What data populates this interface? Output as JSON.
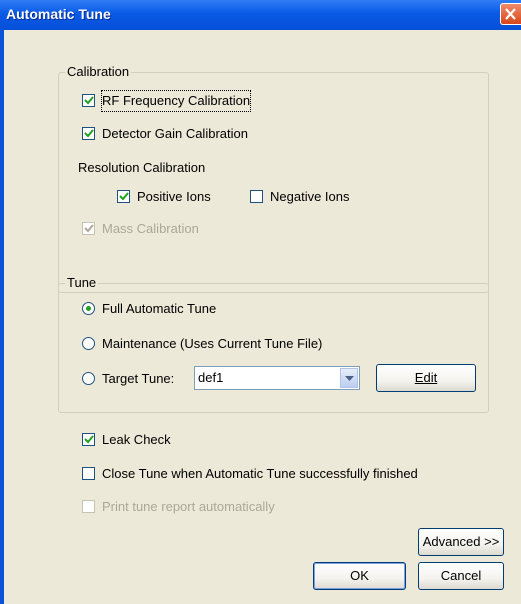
{
  "window": {
    "title": "Automatic Tune"
  },
  "calibration": {
    "label": "Calibration",
    "rf_frequency": {
      "label": "RF Frequency Calibration",
      "checked": true
    },
    "detector_gain": {
      "label": "Detector Gain Calibration",
      "checked": true
    },
    "resolution_label": "Resolution Calibration",
    "positive_ions": {
      "label": "Positive Ions",
      "checked": true
    },
    "negative_ions": {
      "label": "Negative Ions",
      "checked": false
    },
    "mass_calibration": {
      "label": "Mass Calibration",
      "checked": true,
      "disabled": true
    }
  },
  "tune": {
    "label": "Tune",
    "full_auto": {
      "label": "Full Automatic Tune",
      "selected": true
    },
    "maintenance": {
      "label": "Maintenance (Uses Current Tune File)",
      "selected": false
    },
    "target": {
      "label": "Target Tune:",
      "selected": false,
      "value": "def1"
    },
    "edit_label": "Edit"
  },
  "options": {
    "leak_check": {
      "label": "Leak Check",
      "checked": true
    },
    "close_tune": {
      "label": "Close Tune when Automatic Tune successfully finished",
      "checked": false
    },
    "print_report": {
      "label": "Print tune report automatically",
      "checked": false,
      "disabled": true
    }
  },
  "buttons": {
    "advanced": "Advanced >>",
    "ok": "OK",
    "cancel": "Cancel"
  },
  "colors": {
    "titlebar": "#0a5ae6",
    "dialog_bg": "#ece9d8",
    "check_green": "#21a121"
  }
}
